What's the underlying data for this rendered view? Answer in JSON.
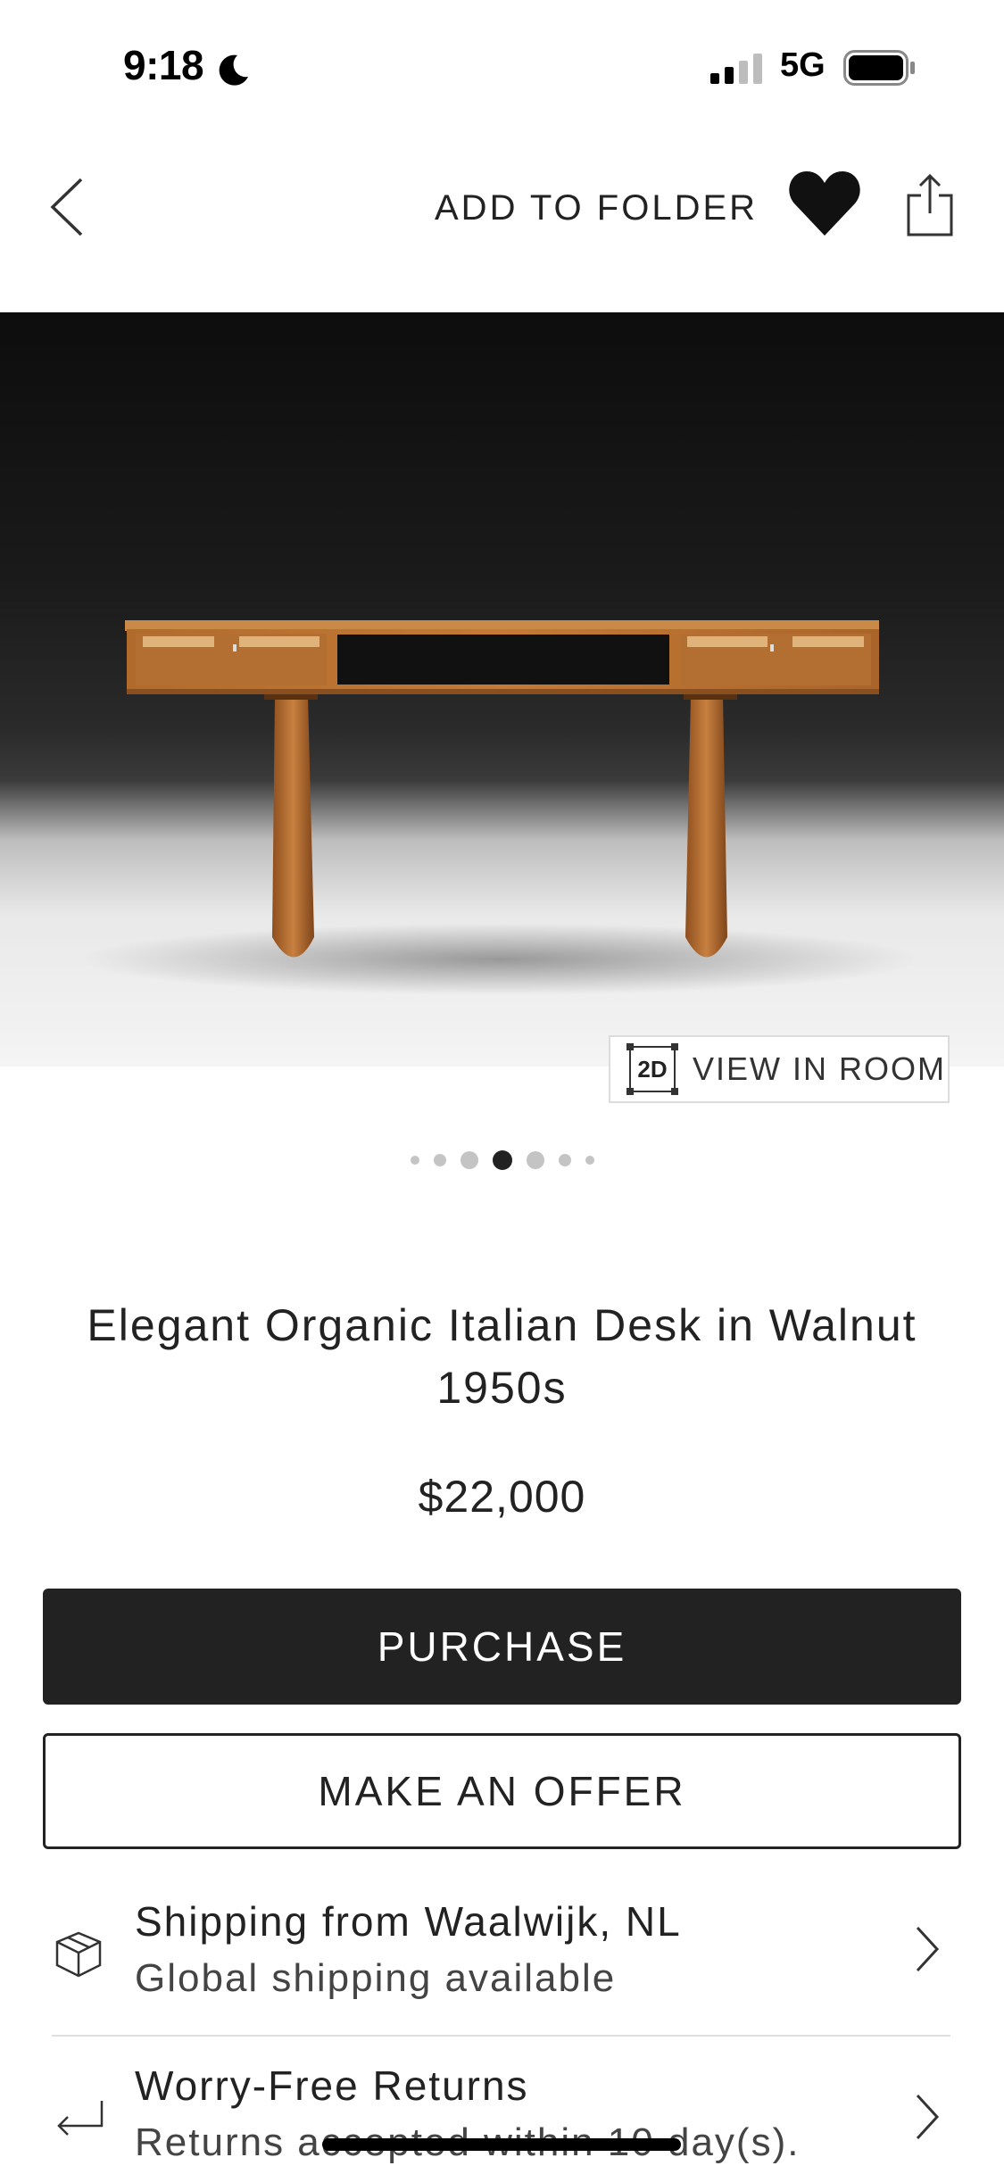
{
  "status_bar": {
    "time": "9:18",
    "network": "5G"
  },
  "nav": {
    "add_to_folder": "ADD TO FOLDER"
  },
  "gallery": {
    "view_in_room_badge": "2D",
    "view_in_room_label": "VIEW IN ROOM",
    "dots_total": 7,
    "active_dot_index": 3
  },
  "product": {
    "title": "Elegant Organic Italian Desk in Walnut 1950s",
    "price": "$22,000"
  },
  "actions": {
    "purchase_label": "PURCHASE",
    "offer_label": "MAKE AN OFFER"
  },
  "info": {
    "shipping_title": "Shipping from Waalwijk, NL",
    "shipping_sub": "Global shipping available",
    "returns_title": "Worry-Free Returns",
    "returns_sub": "Returns accepted within 10 day(s)."
  },
  "colors": {
    "primary": "#222222",
    "background": "#ffffff"
  }
}
